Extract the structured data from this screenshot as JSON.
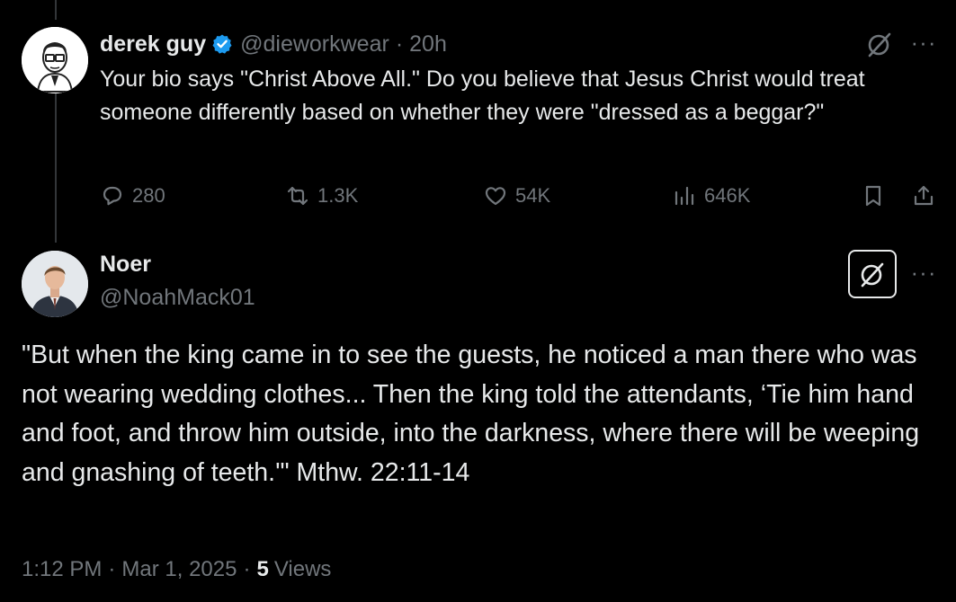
{
  "post1": {
    "author_name": "derek guy",
    "handle": "@dieworkwear",
    "separator": "·",
    "time": "20h",
    "text": "Your bio says \"Christ Above All.\" Do you believe that Jesus Christ would treat someone differently based on whether they were \"dressed as a beggar?\"",
    "verified_color": "#1d9bf0",
    "stats": {
      "replies": "280",
      "reposts": "1.3K",
      "likes": "54K",
      "views": "646K"
    }
  },
  "post2": {
    "author_name": "Noer",
    "handle": "@NoahMack01",
    "text": "\"But when the king came in to see the guests, he noticed a man there who was not wearing wedding clothes... Then  the king told the attendants, ‘Tie him hand and foot, and throw him  outside, into the darkness, where there will be weeping and gnashing of  teeth.'\" Mthw. 22:11-14",
    "meta": {
      "time": "1:12 PM",
      "sep1": "·",
      "date": "Mar 1, 2025",
      "sep2": "·",
      "views_count": "5",
      "views_label": "Views"
    }
  },
  "icons": [
    "reply-icon",
    "repost-icon",
    "like-icon",
    "views-icon",
    "bookmark-icon",
    "share-icon",
    "grok-icon",
    "more-icon",
    "verified-badge-icon"
  ]
}
